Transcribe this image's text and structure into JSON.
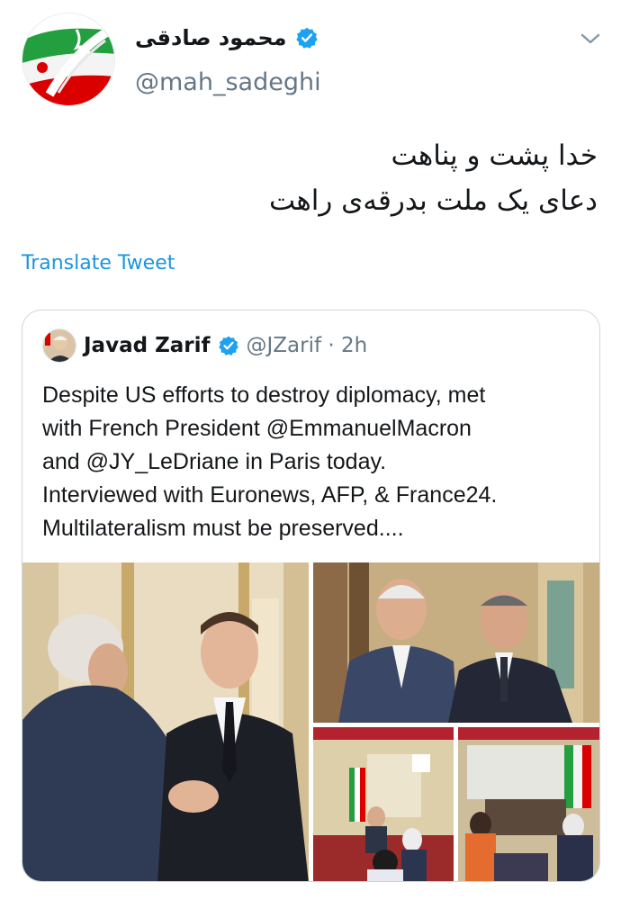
{
  "tweet": {
    "author_name": "محمود صادقی",
    "handle": "@mah_sadeghi",
    "text_lines": [
      "خدا پشت و پناهت",
      "دعای یک ملت بدرقه‌ی راهت"
    ],
    "translate_label": "Translate Tweet"
  },
  "quoted": {
    "author_name": "Javad Zarif",
    "handle_time": "@JZarif · 2h",
    "text_lines": [
      "Despite US efforts to destroy diplomacy, met",
      "with French President @EmmanuelMacron",
      "and @JY_LeDriane in Paris today.",
      "Interviewed with Euronews, AFP,  & France24.",
      "Multilateralism must be preserved...."
    ]
  },
  "colors": {
    "link": "#1b95e0",
    "verified": "#1da1f2",
    "secondary_text": "#657786",
    "border": "#ccd6dd"
  },
  "icons": {
    "verified": "verified-badge-icon",
    "menu": "chevron-down-icon"
  }
}
